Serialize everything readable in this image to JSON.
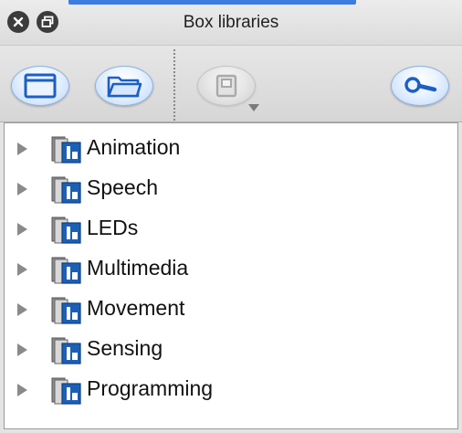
{
  "window": {
    "title": "Box libraries",
    "accent_color": "#3b7de0"
  },
  "title_buttons": [
    {
      "name": "close",
      "icon": "close-icon"
    },
    {
      "name": "restore",
      "icon": "restore-icon"
    }
  ],
  "toolbar": {
    "buttons": [
      {
        "icon": "new-window-icon",
        "enabled": true
      },
      {
        "icon": "open-folder-icon",
        "enabled": true
      },
      {
        "icon": "save-icon",
        "enabled": false,
        "has_dropdown": true
      },
      {
        "icon": "search-icon",
        "enabled": true
      }
    ]
  },
  "tree": {
    "items": [
      {
        "label": "Animation"
      },
      {
        "label": "Speech"
      },
      {
        "label": "LEDs"
      },
      {
        "label": "Multimedia"
      },
      {
        "label": "Movement"
      },
      {
        "label": "Sensing"
      },
      {
        "label": "Programming"
      }
    ]
  }
}
